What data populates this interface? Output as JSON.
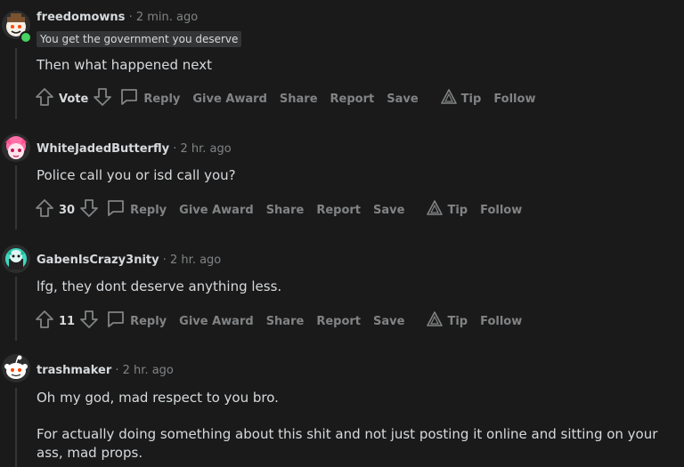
{
  "labels": {
    "reply": "Reply",
    "give_award": "Give Award",
    "share": "Share",
    "report": "Report",
    "save": "Save",
    "tip": "Tip",
    "follow": "Follow",
    "separator": "·"
  },
  "comments": [
    {
      "author": "freedomowns",
      "time": "2 min. ago",
      "flair": "You get the government you deserve",
      "online": true,
      "body": [
        "Then what happened next"
      ],
      "vote": "Vote"
    },
    {
      "author": "WhiteJadedButterfly",
      "time": "2 hr. ago",
      "body": [
        "Police call you or isd call you?"
      ],
      "vote": "30"
    },
    {
      "author": "GabenIsCrazy3nity",
      "time": "2 hr. ago",
      "body": [
        "lfg, they dont deserve anything less."
      ],
      "vote": "11"
    },
    {
      "author": "trashmaker",
      "time": "2 hr. ago",
      "body": [
        "Oh my god, mad respect to you bro.",
        "For actually doing something about this shit and not just posting it online and sitting on your ass, mad props."
      ]
    }
  ]
}
